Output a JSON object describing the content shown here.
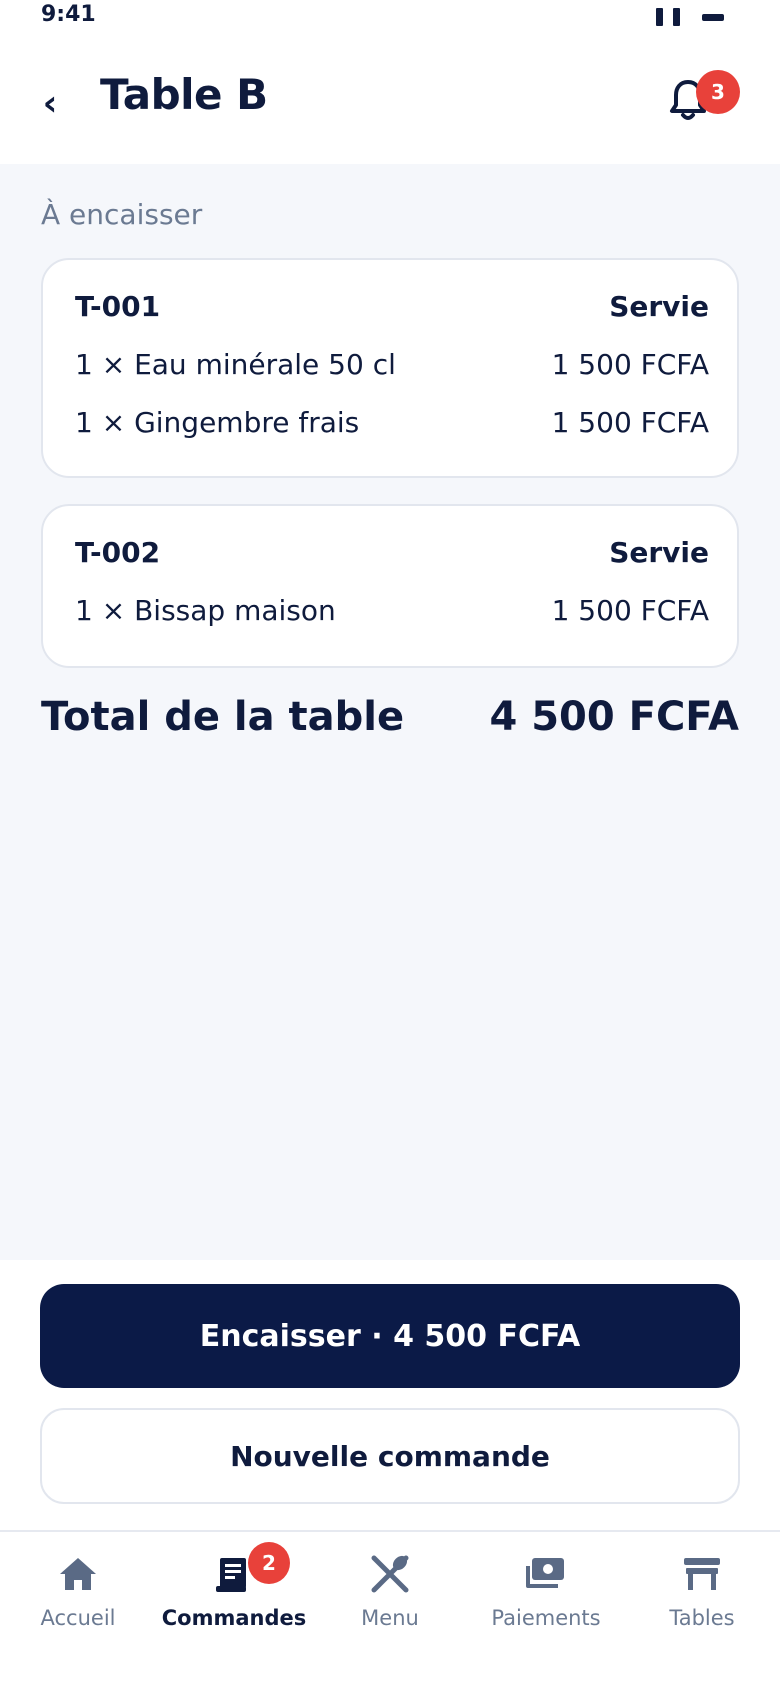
{
  "status_bar": {
    "time": "9:41"
  },
  "header": {
    "title": "Table B",
    "notification_count": "3"
  },
  "section_label": "À encaisser",
  "orders": [
    {
      "id": "T-001",
      "status": "Servie",
      "items": [
        {
          "name": "1 × Eau minérale 50 cl",
          "price": "1 500 FCFA"
        },
        {
          "name": "1 × Gingembre frais",
          "price": "1 500 FCFA"
        }
      ]
    },
    {
      "id": "T-002",
      "status": "Servie",
      "items": [
        {
          "name": "1 × Bissap maison",
          "price": "1 500 FCFA"
        }
      ]
    }
  ],
  "total": {
    "label": "Total de la table",
    "value": "4 500 FCFA"
  },
  "actions": {
    "checkout_label": "Encaisser · 4 500 FCFA",
    "new_order_label": "Nouvelle commande"
  },
  "tabbar": {
    "items": [
      {
        "label": "Accueil",
        "icon": "home-icon",
        "active": false
      },
      {
        "label": "Commandes",
        "icon": "orders-icon",
        "active": true,
        "badge": "2"
      },
      {
        "label": "Menu",
        "icon": "utensils-icon",
        "active": false
      },
      {
        "label": "Paiements",
        "icon": "payments-icon",
        "active": false
      },
      {
        "label": "Tables",
        "icon": "table-icon",
        "active": false
      }
    ]
  },
  "colors": {
    "primary": "#0b1a47",
    "text": "#0f1b3d",
    "muted": "#6b7a92",
    "badge": "#e8413a",
    "background": "#f5f7fb"
  }
}
